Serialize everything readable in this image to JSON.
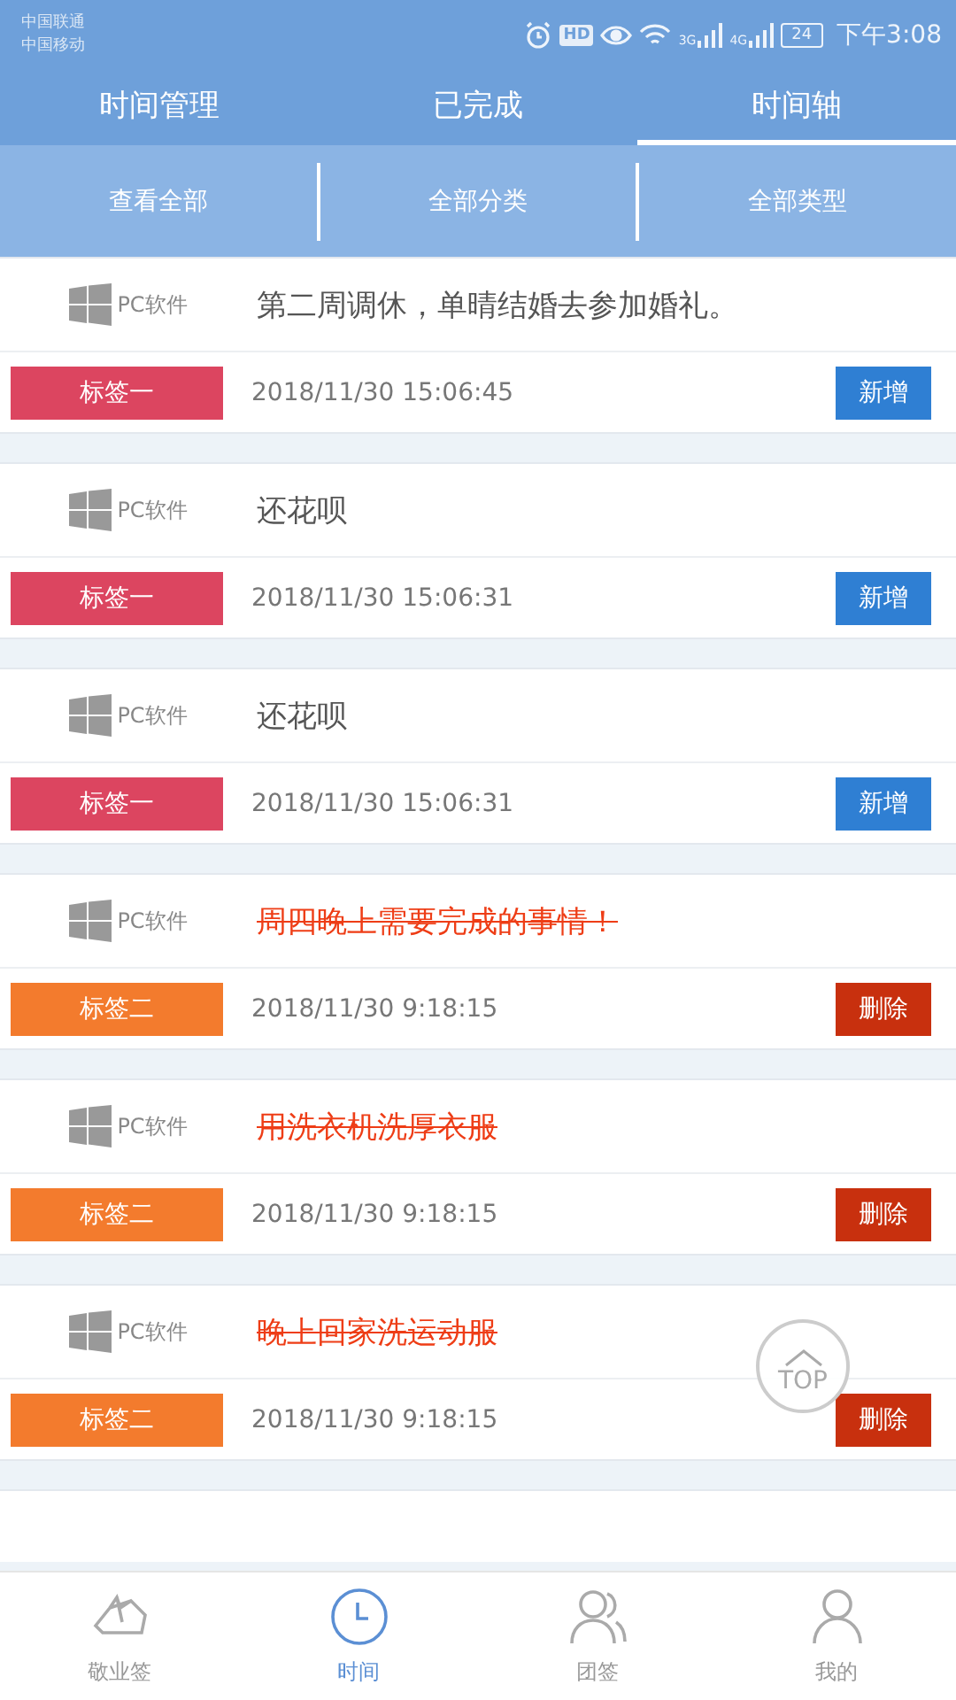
{
  "status_bar": {
    "carriers": [
      "中国联通",
      "中国移动"
    ],
    "hd": "HD",
    "net_1": "3G",
    "net_2": "4G",
    "battery": "24",
    "time": "下午3:08"
  },
  "tabs": [
    {
      "label": "时间管理",
      "selected": false
    },
    {
      "label": "已完成",
      "selected": false
    },
    {
      "label": "时间轴",
      "selected": true
    }
  ],
  "filters": [
    "查看全部",
    "全部分类",
    "全部类型"
  ],
  "entries": [
    {
      "source": "PC软件",
      "title": "第二周调休，单晴结婚去参加婚礼。",
      "done": false,
      "tag": "标签一",
      "color": "#dc4560",
      "time": "2018/11/30  15:06:45",
      "action": {
        "kind": "add",
        "label": "新增"
      }
    },
    {
      "source": "PC软件",
      "title": "还花呗",
      "done": false,
      "tag": "标签一",
      "color": "#dc4560",
      "time": "2018/11/30  15:06:31",
      "action": {
        "kind": "add",
        "label": "新增"
      }
    },
    {
      "source": "PC软件",
      "title": "还花呗",
      "done": false,
      "tag": "标签一",
      "color": "#dc4560",
      "time": "2018/11/30  15:06:31",
      "action": {
        "kind": "add",
        "label": "新增"
      }
    },
    {
      "source": "PC软件",
      "title": "周四晚上需要完成的事情！",
      "done": true,
      "tag": "标签二",
      "color": "#f37b2d",
      "time": "2018/11/30  9:18:15",
      "action": {
        "kind": "delete",
        "label": "删除"
      }
    },
    {
      "source": "PC软件",
      "title": "用洗衣机洗厚衣服",
      "done": true,
      "tag": "标签二",
      "color": "#f37b2d",
      "time": "2018/11/30  9:18:15",
      "action": {
        "kind": "delete",
        "label": "删除"
      }
    },
    {
      "source": "PC软件",
      "title": "晚上回家洗运动服",
      "done": true,
      "tag": "标签二",
      "color": "#f37b2d",
      "time": "2018/11/30  9:18:15",
      "action": {
        "kind": "delete",
        "label": "删除"
      }
    }
  ],
  "top_button": "TOP",
  "nav": [
    {
      "label": "敬业签",
      "selected": false
    },
    {
      "label": "时间",
      "selected": true
    },
    {
      "label": "团签",
      "selected": false
    },
    {
      "label": "我的",
      "selected": false
    }
  ]
}
